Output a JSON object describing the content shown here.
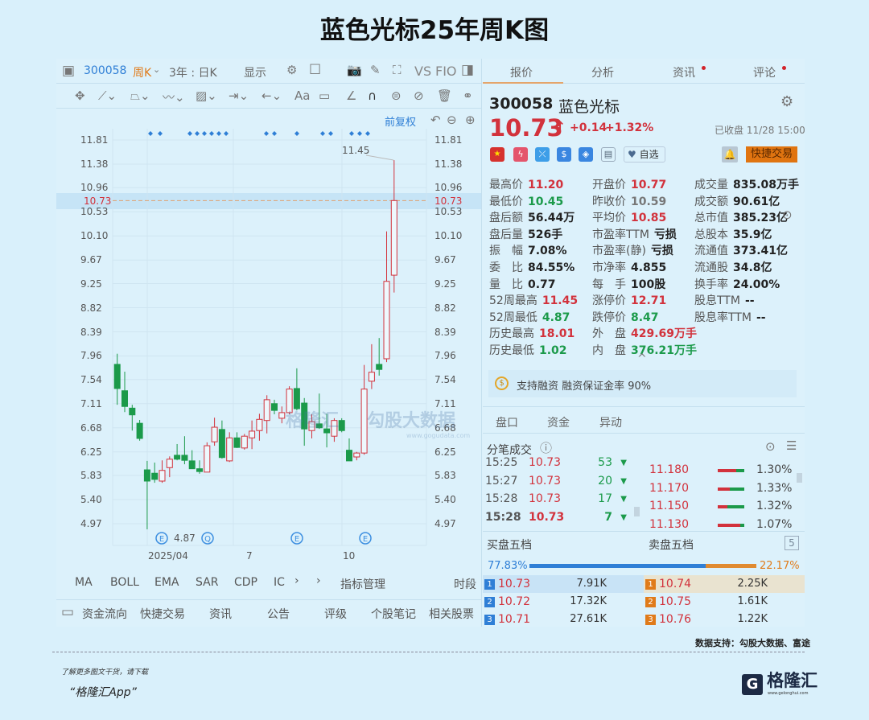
{
  "title": "蓝色光标25年周K图",
  "toolbar": {
    "code": "300058",
    "period": "周K",
    "range": "3年 : 日K",
    "display": "显示",
    "vs": "VS",
    "fio": "FIO",
    "adjust": "前复权"
  },
  "chart_data": {
    "type": "candlestick",
    "title": "蓝色光标25年周K图",
    "y_ticks": [
      "11.81",
      "11.38",
      "10.96",
      "10.53",
      "10.10",
      "9.67",
      "9.25",
      "8.82",
      "8.39",
      "7.96",
      "7.54",
      "7.11",
      "6.68",
      "6.25",
      "5.83",
      "5.40",
      "4.97"
    ],
    "ylim": [
      4.97,
      11.81
    ],
    "x_labels": [
      "2025/04",
      "7",
      "10"
    ],
    "current_price_label": "10.73",
    "high_annotation": "11.45",
    "low_annotation": "4.87",
    "candles": [
      [
        7.81,
        8.0,
        7.09,
        7.38
      ],
      [
        7.34,
        7.68,
        6.96,
        7.06
      ],
      [
        7.03,
        7.09,
        6.63,
        6.91
      ],
      [
        6.76,
        6.82,
        6.45,
        6.49
      ],
      [
        5.93,
        6.09,
        4.87,
        5.73
      ],
      [
        5.87,
        6.06,
        5.7,
        5.76
      ],
      [
        5.73,
        6.1,
        5.7,
        5.92
      ],
      [
        5.97,
        6.17,
        5.8,
        6.12
      ],
      [
        6.19,
        6.39,
        6.1,
        6.12
      ],
      [
        6.19,
        6.53,
        6.03,
        6.1
      ],
      [
        6.09,
        6.28,
        5.95,
        5.95
      ],
      [
        5.95,
        6.1,
        5.86,
        5.9
      ],
      [
        5.89,
        6.42,
        5.89,
        6.36
      ],
      [
        6.43,
        6.86,
        6.36,
        6.69
      ],
      [
        6.65,
        6.81,
        6.13,
        6.15
      ],
      [
        6.09,
        6.6,
        6.07,
        6.5
      ],
      [
        6.5,
        6.6,
        6.32,
        6.33
      ],
      [
        6.32,
        6.57,
        6.29,
        6.53
      ],
      [
        6.5,
        6.81,
        6.3,
        6.62
      ],
      [
        6.63,
        6.93,
        6.45,
        6.83
      ],
      [
        6.81,
        7.26,
        6.58,
        7.18
      ],
      [
        7.11,
        7.18,
        6.92,
        6.99
      ],
      [
        6.85,
        7.06,
        6.76,
        6.95
      ],
      [
        6.95,
        7.42,
        6.92,
        7.37
      ],
      [
        7.38,
        7.74,
        6.99,
        7.02
      ],
      [
        7.12,
        7.21,
        6.36,
        6.66
      ],
      [
        6.63,
        6.92,
        6.49,
        6.79
      ],
      [
        6.75,
        7.29,
        6.66,
        6.68
      ],
      [
        6.66,
        6.93,
        6.33,
        6.59
      ],
      [
        6.53,
        6.85,
        6.43,
        6.81
      ],
      [
        6.81,
        6.85,
        6.6,
        6.63
      ],
      [
        6.28,
        6.49,
        6.09,
        6.09
      ],
      [
        6.16,
        6.25,
        6.1,
        6.23
      ],
      [
        6.23,
        7.8,
        6.2,
        7.37
      ],
      [
        7.51,
        8.17,
        7.37,
        7.67
      ],
      [
        7.81,
        8.28,
        7.61,
        7.72
      ],
      [
        7.91,
        10.18,
        7.85,
        9.29
      ],
      [
        9.4,
        11.45,
        9.09,
        10.73
      ]
    ],
    "candle_fields": [
      "open",
      "high",
      "low",
      "close"
    ],
    "events": [
      {
        "label": "E"
      },
      {
        "label": "Q"
      },
      {
        "label": "E"
      },
      {
        "label": "E"
      }
    ]
  },
  "watermark": {
    "brand": "格隆汇",
    "partner": "勾股大数据",
    "url": "www.gogudata.com"
  },
  "indicators": {
    "items": [
      "MA",
      "BOLL",
      "EMA",
      "SAR",
      "CDP",
      "IC"
    ],
    "manage": "指标管理",
    "period": "时段"
  },
  "bottom_tabs": [
    "资金流向",
    "快捷交易",
    "资讯",
    "公告",
    "评级",
    "个股笔记",
    "相关股票"
  ],
  "right": {
    "tabs": [
      "报价",
      "分析",
      "资讯",
      "评论"
    ],
    "code": "300058",
    "name": "蓝色光标",
    "price": "10.73",
    "change": "+0.14",
    "change_pct": "+1.32%",
    "status": "已收盘 11/28 15:00",
    "watch": "自选",
    "quick_trade": "快捷交易",
    "stats": [
      [
        {
          "l": "最高价",
          "v": "11.20",
          "c": "red"
        },
        {
          "l": "最低价",
          "v": "10.45",
          "c": "green"
        },
        {
          "l": "盘后额",
          "v": "56.44万",
          "c": "dark"
        },
        {
          "l": "盘后量",
          "v": "526手",
          "c": "dark"
        },
        {
          "l": "振　幅",
          "v": "7.08%",
          "c": "dark"
        },
        {
          "l": "委　比",
          "v": "84.55%",
          "c": "dark"
        },
        {
          "l": "量　比",
          "v": "0.77",
          "c": "dark"
        },
        {
          "l": "52周最高",
          "v": "11.45",
          "c": "red"
        },
        {
          "l": "52周最低",
          "v": "4.87",
          "c": "green"
        },
        {
          "l": "历史最高",
          "v": "18.01",
          "c": "red"
        },
        {
          "l": "历史最低",
          "v": "1.02",
          "c": "green"
        }
      ],
      [
        {
          "l": "开盘价",
          "v": "10.77",
          "c": "red"
        },
        {
          "l": "昨收价",
          "v": "10.59",
          "c": "gray"
        },
        {
          "l": "平均价",
          "v": "10.85",
          "c": "red"
        },
        {
          "l": "市盈率TTM",
          "v": "亏损",
          "c": "dark"
        },
        {
          "l": "市盈率(静)",
          "v": "亏损",
          "c": "dark"
        },
        {
          "l": "市净率",
          "v": "4.855",
          "c": "dark"
        },
        {
          "l": "每　手",
          "v": "100股",
          "c": "dark"
        },
        {
          "l": "涨停价",
          "v": "12.71",
          "c": "red"
        },
        {
          "l": "跌停价",
          "v": "8.47",
          "c": "green"
        },
        {
          "l": "外　盘",
          "v": "429.69万手",
          "c": "red"
        },
        {
          "l": "内　盘",
          "v": "376.21万手",
          "c": "green"
        }
      ],
      [
        {
          "l": "成交量",
          "v": "835.08万手",
          "c": "dark"
        },
        {
          "l": "成交额",
          "v": "90.61亿",
          "c": "dark"
        },
        {
          "l": "总市值",
          "v": "385.23亿",
          "c": "dark"
        },
        {
          "l": "总股本",
          "v": "35.9亿",
          "c": "dark"
        },
        {
          "l": "流通值",
          "v": "373.41亿",
          "c": "dark"
        },
        {
          "l": "流通股",
          "v": "34.8亿",
          "c": "dark"
        },
        {
          "l": "换手率",
          "v": "24.00%",
          "c": "dark"
        },
        {
          "l": "股息TTM",
          "v": "--",
          "c": "dark"
        },
        {
          "l": "股息率TTM",
          "v": "--",
          "c": "dark"
        }
      ]
    ],
    "margin": "支持融资 融资保证金率 90%",
    "sub_tabs": [
      "盘口",
      "资金",
      "异动"
    ],
    "ticks_title": "分笔成交",
    "ticks": [
      {
        "t": "15:25",
        "p": "10.73",
        "v": "53"
      },
      {
        "t": "15:27",
        "p": "10.73",
        "v": "20"
      },
      {
        "t": "15:28",
        "p": "10.73",
        "v": "17"
      },
      {
        "t": "15:28",
        "p": "10.73",
        "v": "7"
      }
    ],
    "dist": [
      {
        "p": "11.180",
        "pct": "1.30%",
        "red": 0.7
      },
      {
        "p": "11.170",
        "pct": "1.33%",
        "red": 0.45
      },
      {
        "p": "11.150",
        "pct": "1.32%",
        "red": 0.35
      },
      {
        "p": "11.130",
        "pct": "1.07%",
        "red": 0.85
      }
    ],
    "bid_title": "买盘五档",
    "ask_title": "卖盘五档",
    "depth": "5",
    "bid_ratio": "77.83%",
    "ask_ratio": "22.17%",
    "bid_frac": 0.7783,
    "bids": [
      {
        "n": "1",
        "p": "10.73",
        "v": "7.91K"
      },
      {
        "n": "2",
        "p": "10.72",
        "v": "17.32K"
      },
      {
        "n": "3",
        "p": "10.71",
        "v": "27.61K"
      }
    ],
    "asks": [
      {
        "n": "1",
        "p": "10.74",
        "v": "2.25K"
      },
      {
        "n": "2",
        "p": "10.75",
        "v": "1.61K"
      },
      {
        "n": "3",
        "p": "10.76",
        "v": "1.22K"
      }
    ]
  },
  "footer": {
    "source": "数据支持：勾股大数据、富途",
    "promo": "了解更多图文干货，请下载",
    "app": "“格隆汇App”",
    "logo": "格隆汇",
    "logo_url": "www.gelonghui.com"
  },
  "colors": {
    "up": "#d2323c",
    "down": "#1b9a4a",
    "accent": "#e07b1a",
    "blue": "#2f7fd6"
  }
}
